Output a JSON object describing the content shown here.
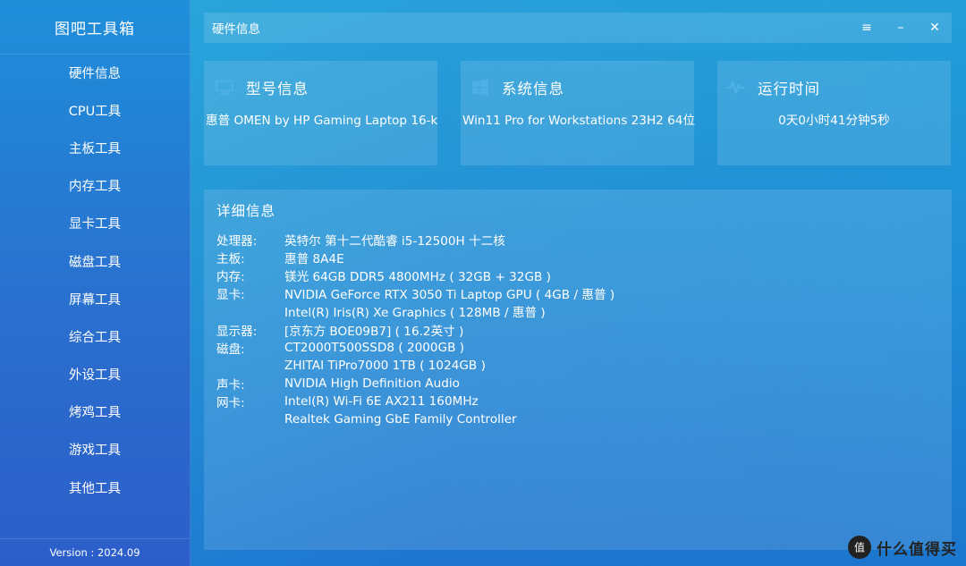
{
  "app": {
    "title": "图吧工具箱",
    "version": "Version : 2024.09"
  },
  "sidebar": {
    "items": [
      {
        "label": "硬件信息"
      },
      {
        "label": "CPU工具"
      },
      {
        "label": "主板工具"
      },
      {
        "label": "内存工具"
      },
      {
        "label": "显卡工具"
      },
      {
        "label": "磁盘工具"
      },
      {
        "label": "屏幕工具"
      },
      {
        "label": "综合工具"
      },
      {
        "label": "外设工具"
      },
      {
        "label": "烤鸡工具"
      },
      {
        "label": "游戏工具"
      },
      {
        "label": "其他工具"
      }
    ]
  },
  "titlebar": {
    "title": "硬件信息",
    "menu_glyph": "≡",
    "minimize_glyph": "–",
    "close_glyph": "✕"
  },
  "cards": {
    "model": {
      "title": "型号信息",
      "value": "惠普 OMEN by HP Gaming Laptop 16-k",
      "icon": "monitor-icon"
    },
    "system": {
      "title": "系统信息",
      "value": "Win11 Pro for Workstations 23H2 64位",
      "icon": "windows-icon"
    },
    "uptime": {
      "title": "运行时间",
      "value": "0天0小时41分钟5秒",
      "icon": "pulse-icon"
    }
  },
  "details": {
    "title": "详细信息",
    "rows": [
      {
        "key": "处理器:",
        "value": "英特尔 第十二代酷睿 i5-12500H 十二核"
      },
      {
        "key": "主板:",
        "value": "惠普 8A4E"
      },
      {
        "key": "内存:",
        "value": "镁光 64GB DDR5 4800MHz ( 32GB + 32GB )"
      },
      {
        "key": "显卡:",
        "value": "NVIDIA GeForce RTX 3050 Ti Laptop GPU ( 4GB / 惠普 )"
      },
      {
        "key": "",
        "value": "Intel(R) Iris(R) Xe Graphics ( 128MB / 惠普 )"
      },
      {
        "key": "显示器:",
        "value": "[京东方 BOE09B7] ( 16.2英寸 )"
      },
      {
        "key": "磁盘:",
        "value": "CT2000T500SSD8 ( 2000GB )"
      },
      {
        "key": "",
        "value": "ZHITAI TiPro7000 1TB ( 1024GB )"
      },
      {
        "key": "声卡:",
        "value": "NVIDIA High Definition Audio"
      },
      {
        "key": "网卡:",
        "value": "Intel(R) Wi-Fi 6E AX211 160MHz"
      },
      {
        "key": "",
        "value": "Realtek Gaming GbE Family Controller"
      }
    ]
  },
  "watermark": {
    "text": "什么值得买",
    "glyph": "值"
  },
  "colors": {
    "accent": "#2596d6",
    "sidebar_top": "#1f8fda",
    "sidebar_bottom": "#2c5ec9"
  }
}
